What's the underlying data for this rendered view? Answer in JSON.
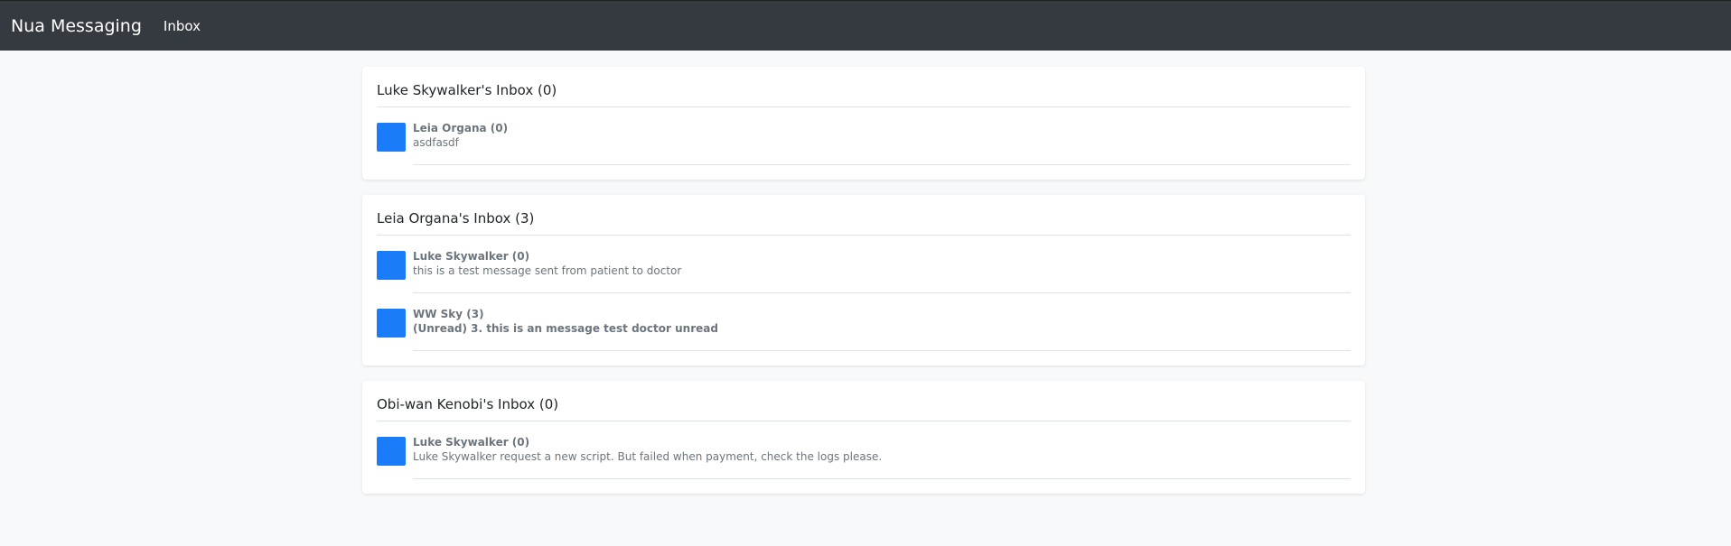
{
  "navbar": {
    "brand": "Nua Messaging",
    "inbox_link": "Inbox"
  },
  "inboxes": [
    {
      "title": "Luke Skywalker's Inbox (0)",
      "messages": [
        {
          "sender": "Leia Organa (0)",
          "preview": "asdfasdf",
          "unread": false
        }
      ]
    },
    {
      "title": "Leia Organa's Inbox (3)",
      "messages": [
        {
          "sender": "Luke Skywalker (0)",
          "preview": "this is a test message sent from patient to doctor",
          "unread": false
        },
        {
          "sender": "WW Sky (3)",
          "preview": "(Unread) 3. this is an message test doctor unread",
          "unread": true
        }
      ]
    },
    {
      "title": "Obi-wan Kenobi's Inbox (0)",
      "messages": [
        {
          "sender": "Luke Skywalker (0)",
          "preview": "Luke Skywalker request a new script. But failed when payment, check the logs please.",
          "unread": false
        }
      ]
    }
  ],
  "colors": {
    "navbar": "#343a40",
    "avatar": "#1a7cf8",
    "background": "#f8f9fa"
  }
}
